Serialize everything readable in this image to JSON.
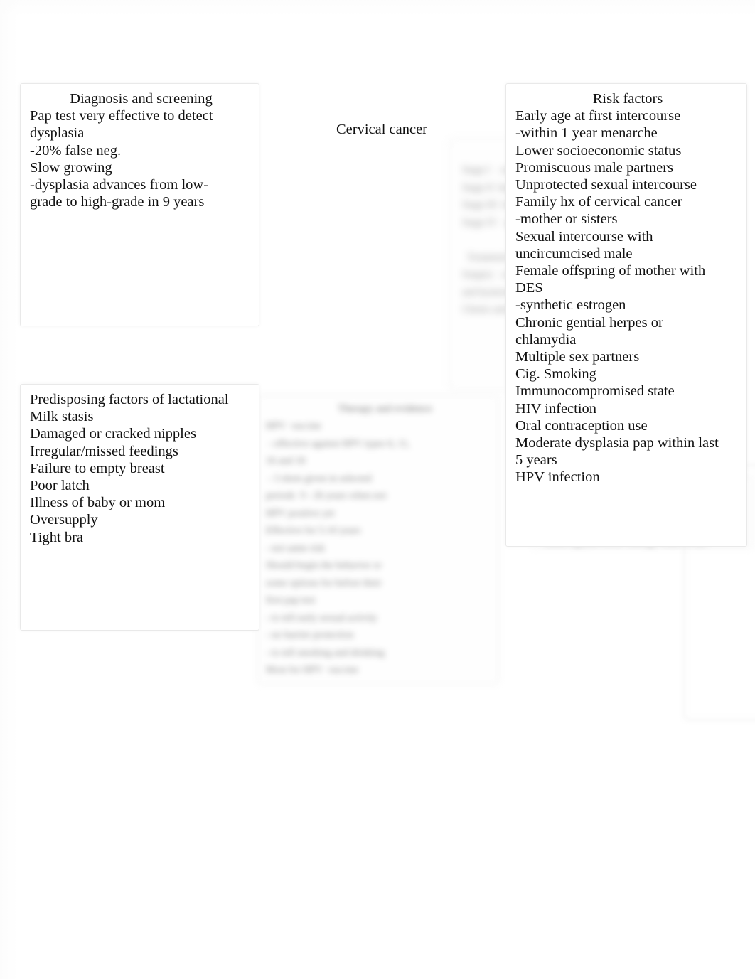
{
  "page": {
    "background_color": "#ffffff",
    "text_color": "#111111",
    "box_border_color": "#e9e9e9"
  },
  "center_label": {
    "text": "Cervical cancer"
  },
  "diagnosis_box": {
    "title": "Diagnosis and screening",
    "lines": [
      "Pap test very effective to detect",
      "dysplasia",
      "-20% false neg.",
      "Slow growing",
      "-dysplasia advances from low-",
      "grade to high-grade in 9 years"
    ]
  },
  "risk_box": {
    "title": "Risk factors",
    "lines": [
      "Early age at first intercourse",
      "-within 1 year menarche",
      "Lower socioeconomic status",
      "Promiscuous male partners",
      "Unprotected sexual intercourse",
      "Family hx of cervical cancer",
      "-mother or sisters",
      "Sexual intercourse with",
      "uncircumcised male",
      "Female offspring of mother with",
      "DES",
      "-synthetic estrogen",
      "Chronic gential herpes or",
      "chlamydia",
      "Multiple sex partners",
      "Cig. Smoking",
      "Immunocompromised state",
      "HIV infection",
      "Oral contraception use",
      "Moderate dysplasia pap within last",
      "5 years",
      "HPV infection"
    ]
  },
  "lactational_box": {
    "title": "Predisposing factors of lactational",
    "lines": [
      "Milk stasis",
      "Damaged or cracked nipples",
      "Irregular/missed feedings",
      "Failure to empty breast",
      "Poor latch",
      "Illness of baby or mom",
      "Oversupply",
      "Tight bra"
    ]
  },
  "blurred_boxes": [
    {
      "name": "center-column",
      "legible": false,
      "title": "",
      "lines": [
        "",
        "",
        "",
        "",
        "",
        "",
        "",
        "",
        "",
        "",
        "",
        ""
      ]
    },
    {
      "name": "middle-bottom",
      "legible": false,
      "title": "",
      "lines": [
        "",
        "",
        "",
        "",
        "",
        "",
        "",
        "",
        "",
        "",
        "",
        "",
        "",
        "",
        ""
      ]
    },
    {
      "name": "management",
      "legible": false,
      "title": "",
      "lines": [
        "",
        "",
        ""
      ]
    }
  ]
}
